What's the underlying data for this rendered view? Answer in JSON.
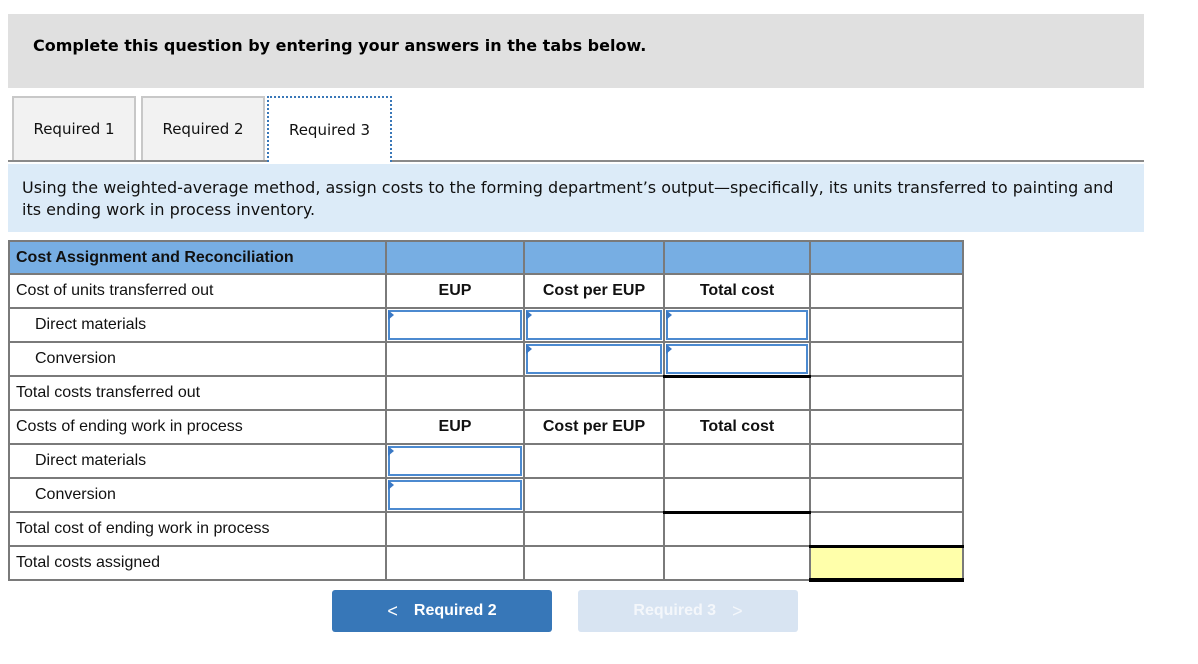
{
  "header": {
    "title": "Complete this question by entering your answers in the tabs below."
  },
  "tabs": [
    {
      "label": "Required 1",
      "active": false
    },
    {
      "label": "Required 2",
      "active": false
    },
    {
      "label": "Required 3",
      "active": true
    }
  ],
  "instructions": "Using the weighted-average method, assign costs to the forming department’s output—specifically, its units transferred to painting and its ending work in process inventory.",
  "table": {
    "title": "Cost Assignment and Reconciliation",
    "column_headers": {
      "eup": "EUP",
      "cost_per_eup": "Cost per EUP",
      "total_cost": "Total cost"
    },
    "rows": {
      "transferred_out": "Cost of units transferred out",
      "to_direct_materials": "Direct materials",
      "to_conversion": "Conversion",
      "total_transferred_out": "Total costs transferred out",
      "ending_wip": "Costs of ending work in process",
      "ewip_direct_materials": "Direct materials",
      "ewip_conversion": "Conversion",
      "total_ending_wip": "Total cost of ending work in process",
      "total_assigned": "Total costs assigned"
    },
    "inputs": {
      "to_dm_eup": "",
      "to_dm_cost_per_eup": "",
      "to_dm_total": "",
      "to_conv_cost_per_eup": "",
      "to_conv_total": "",
      "ewip_dm_eup": "",
      "ewip_conv_eup": ""
    }
  },
  "navigation": {
    "prev_label": "Required 2",
    "next_label": "Required 3",
    "prev_icon": "chevron-left-icon",
    "next_icon": "chevron-right-icon",
    "prev_glyph": "<",
    "next_glyph": ">"
  }
}
